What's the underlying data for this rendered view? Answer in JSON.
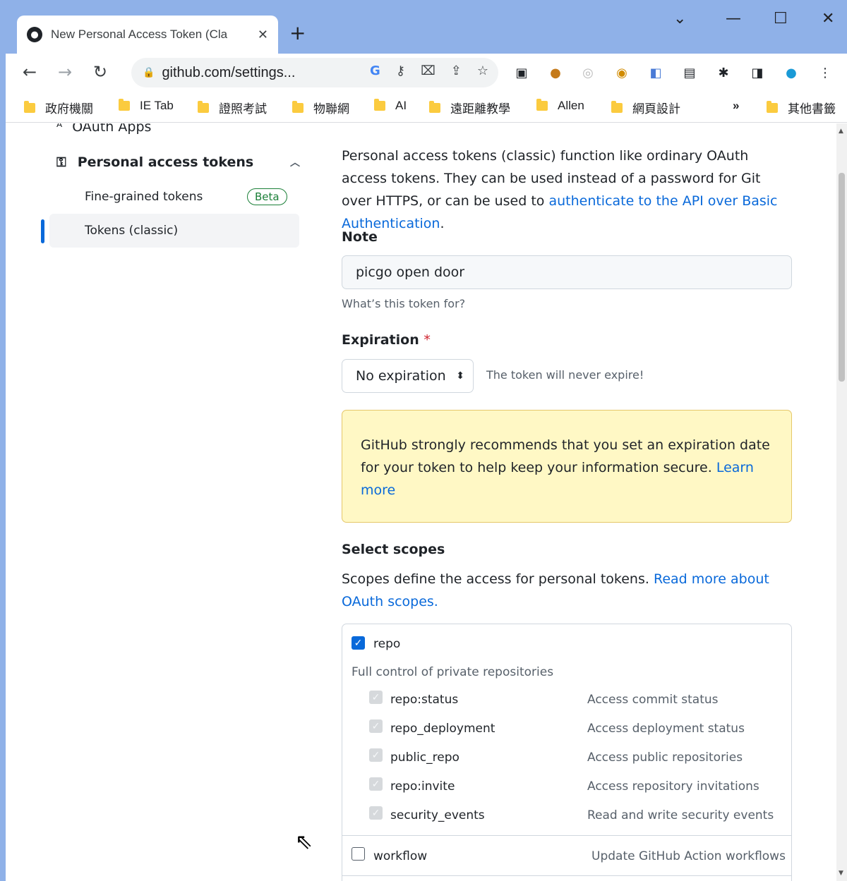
{
  "browser": {
    "tab_title": "New Personal Access Token (Cla",
    "url": "github.com/settings...",
    "bookmarks": [
      "政府機關",
      "IE Tab",
      "證照考試",
      "物聯網",
      "AI",
      "遠距離教學",
      "Allen",
      "網頁設計",
      "其他書籤"
    ],
    "more_bookmarks": "»"
  },
  "sidebar": {
    "oauth_apps": "OAuth Apps",
    "personal_access_tokens": "Personal access tokens",
    "fine_grained": "Fine-grained tokens",
    "beta": "Beta",
    "tokens_classic": "Tokens (classic)"
  },
  "main": {
    "intro_text": "Personal access tokens (classic) function like ordinary OAuth access tokens. They can be used instead of a password for Git over HTTPS, or can be used to ",
    "intro_link": "authenticate to the API over Basic Authentication",
    "intro_end": ".",
    "note_label": "Note",
    "note_value": "picgo open door",
    "note_hint": "What’s this token for?",
    "expiration_label": "Expiration",
    "required_mark": "*",
    "expiration_value": "No expiration",
    "expiration_msg": "The token will never expire!",
    "warning_text": "GitHub strongly recommends that you set an expiration date for your token to help keep your information secure. ",
    "warning_link": "Learn more",
    "scopes_label": "Select scopes",
    "scopes_desc": "Scopes define the access for personal tokens. ",
    "scopes_link": "Read more about OAuth scopes."
  },
  "scopes": {
    "repo": {
      "name": "repo",
      "checked": true,
      "desc": "Full control of private repositories"
    },
    "repo_children": [
      {
        "name": "repo:status",
        "desc": "Access commit status"
      },
      {
        "name": "repo_deployment",
        "desc": "Access deployment status"
      },
      {
        "name": "public_repo",
        "desc": "Access public repositories"
      },
      {
        "name": "repo:invite",
        "desc": "Access repository invitations"
      },
      {
        "name": "security_events",
        "desc": "Read and write security events"
      }
    ],
    "workflow": {
      "name": "workflow",
      "checked": false,
      "desc": "Update GitHub Action workflows"
    }
  }
}
